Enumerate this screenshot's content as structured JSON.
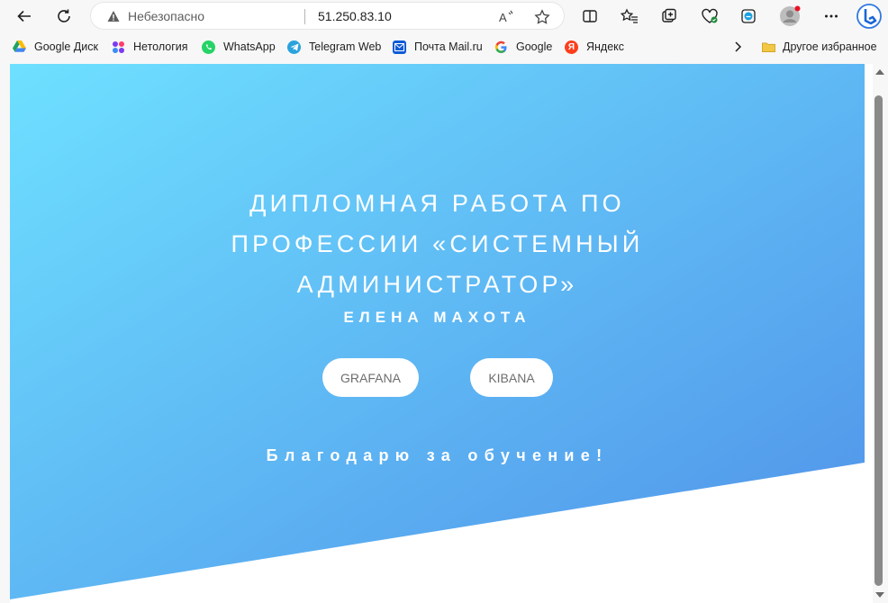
{
  "browser": {
    "address_bar": {
      "security_label": "Небезопасно",
      "url": "51.250.83.10"
    },
    "bookmarks": [
      {
        "label": "Google Диск",
        "icon": "google-drive-icon"
      },
      {
        "label": "Нетология",
        "icon": "netology-icon"
      },
      {
        "label": "WhatsApp",
        "icon": "whatsapp-icon"
      },
      {
        "label": "Telegram Web",
        "icon": "telegram-icon"
      },
      {
        "label": "Почта Mail.ru",
        "icon": "mail-icon"
      },
      {
        "label": "Google",
        "icon": "google-icon"
      },
      {
        "label": "Яндекс",
        "icon": "yandex-icon"
      }
    ],
    "other_favorites": "Другое избранное"
  },
  "page": {
    "title_lines": [
      "ДИПЛОМНАЯ РАБОТА ПО",
      "ПРОФЕССИИ «СИСТЕМНЫЙ",
      "АДМИНИСТРАТОР»"
    ],
    "author": "ЕЛЕНА МАХОТА",
    "buttons": {
      "grafana": "GRAFANA",
      "kibana": "KIBANA"
    },
    "thanks": "Благодарю за обучение!"
  },
  "colors": {
    "gradient_start": "#6ee0ff",
    "gradient_end": "#4f90e8",
    "accent_blue": "#0d6efd"
  }
}
